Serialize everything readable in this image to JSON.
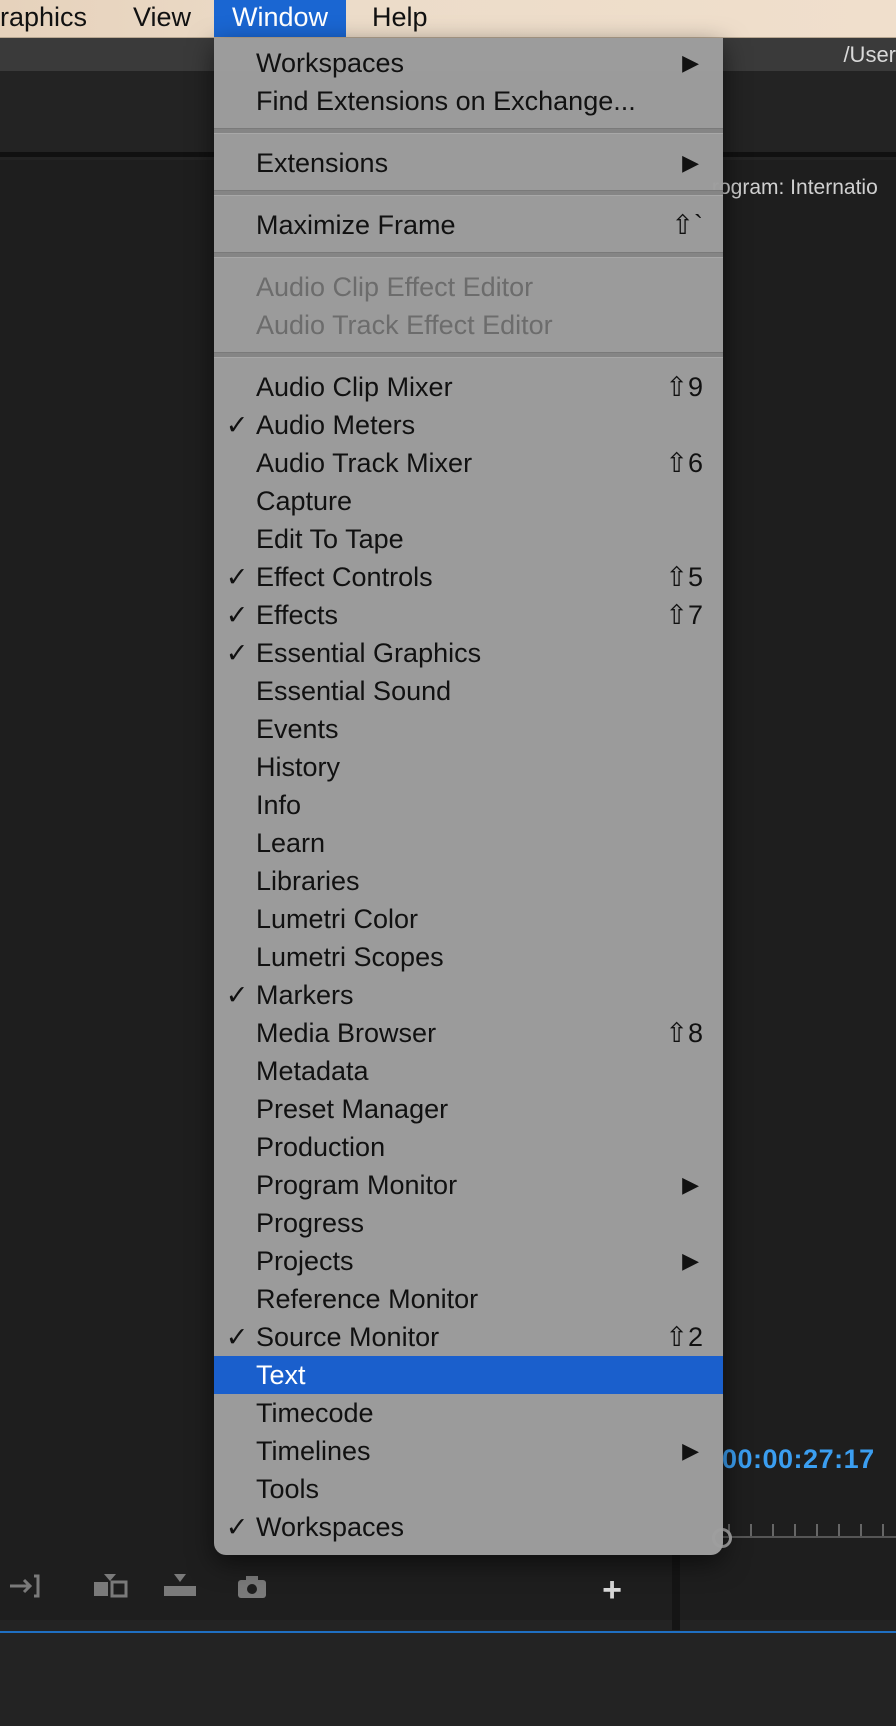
{
  "menubar": {
    "items": [
      {
        "label": "raphics"
      },
      {
        "label": "View"
      },
      {
        "label": "Window",
        "active": true
      },
      {
        "label": "Help"
      }
    ]
  },
  "app": {
    "path_text": "/User",
    "program_title": "rogram: Internatio",
    "timecode": "00:00:27:17"
  },
  "window_menu": {
    "items": [
      {
        "label": "Workspaces",
        "checked": false,
        "shortcut": "",
        "submenu": true
      },
      {
        "label": "Find Extensions on Exchange...",
        "checked": false,
        "shortcut": "",
        "submenu": false
      },
      {
        "label": "Extensions",
        "checked": false,
        "shortcut": "",
        "submenu": true
      },
      {
        "label": "Maximize Frame",
        "checked": false,
        "shortcut": "⇧`",
        "submenu": false
      },
      {
        "label": "Audio Clip Effect Editor",
        "checked": false,
        "shortcut": "",
        "submenu": false,
        "disabled": true
      },
      {
        "label": "Audio Track Effect Editor",
        "checked": false,
        "shortcut": "",
        "submenu": false,
        "disabled": true
      },
      {
        "label": "Audio Clip Mixer",
        "checked": false,
        "shortcut": "⇧9",
        "submenu": false
      },
      {
        "label": "Audio Meters",
        "checked": true,
        "shortcut": "",
        "submenu": false
      },
      {
        "label": "Audio Track Mixer",
        "checked": false,
        "shortcut": "⇧6",
        "submenu": false
      },
      {
        "label": "Capture",
        "checked": false,
        "shortcut": "",
        "submenu": false
      },
      {
        "label": "Edit To Tape",
        "checked": false,
        "shortcut": "",
        "submenu": false
      },
      {
        "label": "Effect Controls",
        "checked": true,
        "shortcut": "⇧5",
        "submenu": false
      },
      {
        "label": "Effects",
        "checked": true,
        "shortcut": "⇧7",
        "submenu": false
      },
      {
        "label": "Essential Graphics",
        "checked": true,
        "shortcut": "",
        "submenu": false
      },
      {
        "label": "Essential Sound",
        "checked": false,
        "shortcut": "",
        "submenu": false
      },
      {
        "label": "Events",
        "checked": false,
        "shortcut": "",
        "submenu": false
      },
      {
        "label": "History",
        "checked": false,
        "shortcut": "",
        "submenu": false
      },
      {
        "label": "Info",
        "checked": false,
        "shortcut": "",
        "submenu": false
      },
      {
        "label": "Learn",
        "checked": false,
        "shortcut": "",
        "submenu": false
      },
      {
        "label": "Libraries",
        "checked": false,
        "shortcut": "",
        "submenu": false
      },
      {
        "label": "Lumetri Color",
        "checked": false,
        "shortcut": "",
        "submenu": false
      },
      {
        "label": "Lumetri Scopes",
        "checked": false,
        "shortcut": "",
        "submenu": false
      },
      {
        "label": "Markers",
        "checked": true,
        "shortcut": "",
        "submenu": false
      },
      {
        "label": "Media Browser",
        "checked": false,
        "shortcut": "⇧8",
        "submenu": false
      },
      {
        "label": "Metadata",
        "checked": false,
        "shortcut": "",
        "submenu": false
      },
      {
        "label": "Preset Manager",
        "checked": false,
        "shortcut": "",
        "submenu": false
      },
      {
        "label": "Production",
        "checked": false,
        "shortcut": "",
        "submenu": false
      },
      {
        "label": "Program Monitor",
        "checked": false,
        "shortcut": "",
        "submenu": true
      },
      {
        "label": "Progress",
        "checked": false,
        "shortcut": "",
        "submenu": false
      },
      {
        "label": "Projects",
        "checked": false,
        "shortcut": "",
        "submenu": true
      },
      {
        "label": "Reference Monitor",
        "checked": false,
        "shortcut": "",
        "submenu": false
      },
      {
        "label": "Source Monitor",
        "checked": true,
        "shortcut": "⇧2",
        "submenu": false
      },
      {
        "label": "Text",
        "checked": false,
        "shortcut": "",
        "submenu": false,
        "selected": true
      },
      {
        "label": "Timecode",
        "checked": false,
        "shortcut": "",
        "submenu": false
      },
      {
        "label": "Timelines",
        "checked": false,
        "shortcut": "",
        "submenu": true
      },
      {
        "label": "Tools",
        "checked": false,
        "shortcut": "",
        "submenu": false
      },
      {
        "label": "Workspaces",
        "checked": true,
        "shortcut": "",
        "submenu": false
      }
    ],
    "check_glyph": "✓",
    "submenu_glyph": "▶"
  },
  "colors": {
    "menu_highlight": "#1a5fcc",
    "timecode": "#3b9ef0",
    "disabled_text": "#6c6c6c"
  },
  "icons": [
    "mark-out-icon",
    "insert-icon",
    "overwrite-icon",
    "export-frame-icon",
    "add-icon"
  ]
}
